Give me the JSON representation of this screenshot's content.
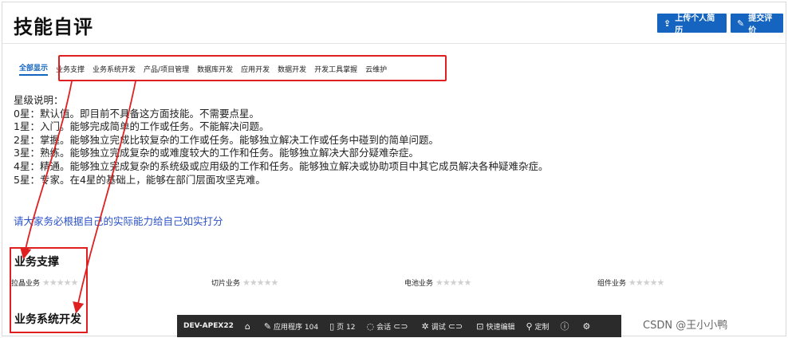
{
  "page_title": "技能自评",
  "header_buttons": {
    "upload_label": "上传个人简历",
    "upload_icon": "upload-icon",
    "submit_label": "提交评价",
    "submit_icon": "edit-icon"
  },
  "tabs": [
    {
      "label": "全部显示",
      "active": true
    },
    {
      "label": "业务支撑"
    },
    {
      "label": "业务系统开发"
    },
    {
      "label": "产品/项目管理"
    },
    {
      "label": "数据库开发"
    },
    {
      "label": "应用开发"
    },
    {
      "label": "数据开发"
    },
    {
      "label": "开发工具掌握"
    },
    {
      "label": "云维护"
    }
  ],
  "rating_description": [
    "星级说明：",
    "0星：默认值。即目前不具备这方面技能。不需要点星。",
    "1星：入门。能够完成简单的工作或任务。不能解决问题。",
    "2星：掌握。能够独立完成比较复杂的工作或任务。能够独立解决工作或任务中碰到的简单问题。",
    "3星：熟练。能够独立完成复杂的或难度较大的工作和任务。能够独立解决大部分疑难杂症。",
    "4星：精通。能够独立完成复杂的系统级或应用级的工作和任务。能够独立解决或协助项目中其它成员解决各种疑难杂症。",
    "5星：专家。在4星的基础上，能够在部门层面攻坚克难。"
  ],
  "notice": "请大家务必根据自己的实际能力给自己如实打分",
  "sections": {
    "biz_support": {
      "title": "业务支撑",
      "skills": [
        {
          "name": "拉晶业务",
          "rating": 0
        },
        {
          "name": "切片业务",
          "rating": 0
        },
        {
          "name": "电池业务",
          "rating": 0
        },
        {
          "name": "组件业务",
          "rating": 0
        }
      ]
    },
    "biz_dev": {
      "title": "业务系统开发"
    }
  },
  "dev_toolbar": {
    "env": "DEV-APEX22",
    "home_icon": "home-icon",
    "application": "应用程序 104",
    "page": "页 12",
    "session": "会话",
    "debug": "调试",
    "quick_edit": "快速编辑",
    "customize": "定制"
  },
  "watermark": "CSDN @王小小鸭",
  "colors": {
    "primary": "#1565c0",
    "annotation_red": "#e02020",
    "toolbar_bg": "#2b2b2b",
    "notice_blue": "#2a52c9"
  }
}
